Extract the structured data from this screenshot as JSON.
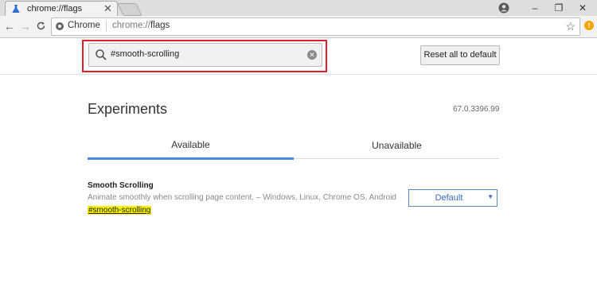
{
  "browser": {
    "tab": {
      "title": "chrome://flags",
      "close": "✕"
    },
    "window_controls": {
      "minimize": "–",
      "maximize": "❐",
      "close": "✕"
    },
    "omnibox": {
      "chip": "Chrome",
      "url_scheme": "chrome://",
      "url_path": "flags"
    },
    "extension_badge": "!"
  },
  "flags_page": {
    "search": {
      "value": "#smooth-scrolling"
    },
    "reset_button": "Reset all to default",
    "title": "Experiments",
    "version": "67.0.3396.99",
    "tabs": [
      {
        "label": "Available",
        "selected": true
      },
      {
        "label": "Unavailable",
        "selected": false
      }
    ],
    "experiment": {
      "name": "Smooth Scrolling",
      "description": "Animate smoothly when scrolling page content. – Windows, Linux, Chrome OS, Android",
      "link": "#smooth-scrolling",
      "selected_option": "Default"
    }
  },
  "colors": {
    "highlight_border": "#e0202a",
    "tab_underline": "#4a8ae6",
    "link_highlight": "#f6f200",
    "select_accent": "#3a6bc0"
  }
}
